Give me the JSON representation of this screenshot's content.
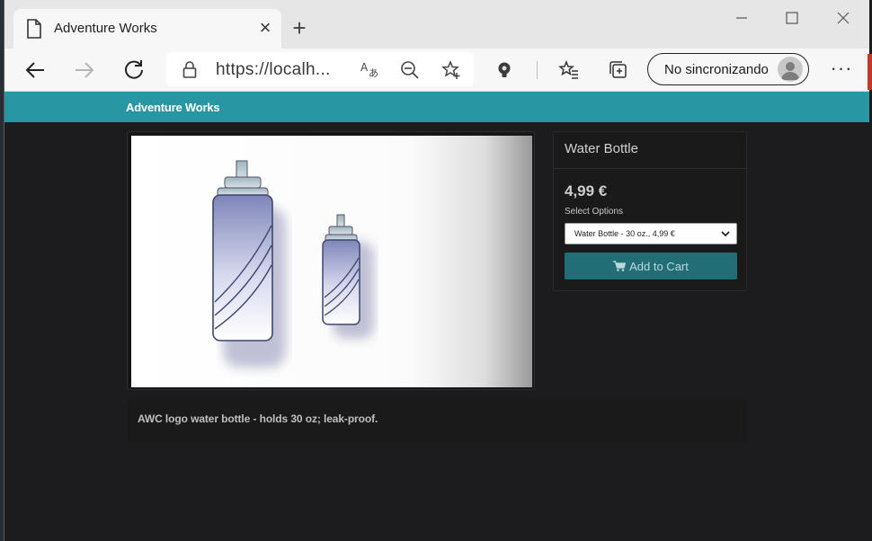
{
  "browser": {
    "tab": {
      "title": "Adventure Works",
      "icon": "page-icon"
    },
    "address": {
      "url": "https://localh..."
    },
    "sync_label": "No sincronizando",
    "more_label": "···",
    "new_tab_label": "+",
    "close_tab_label": "×"
  },
  "site": {
    "brand": "Adventure Works",
    "accent_color": "#2896a3"
  },
  "product": {
    "name": "Water Bottle",
    "price": "4,99 €",
    "options_label": "Select Options",
    "selected_option": "Water Bottle - 30 oz., 4,99 €",
    "add_to_cart_label": "Add to Cart",
    "description": "AWC logo water bottle - holds 30 oz; leak-proof."
  }
}
